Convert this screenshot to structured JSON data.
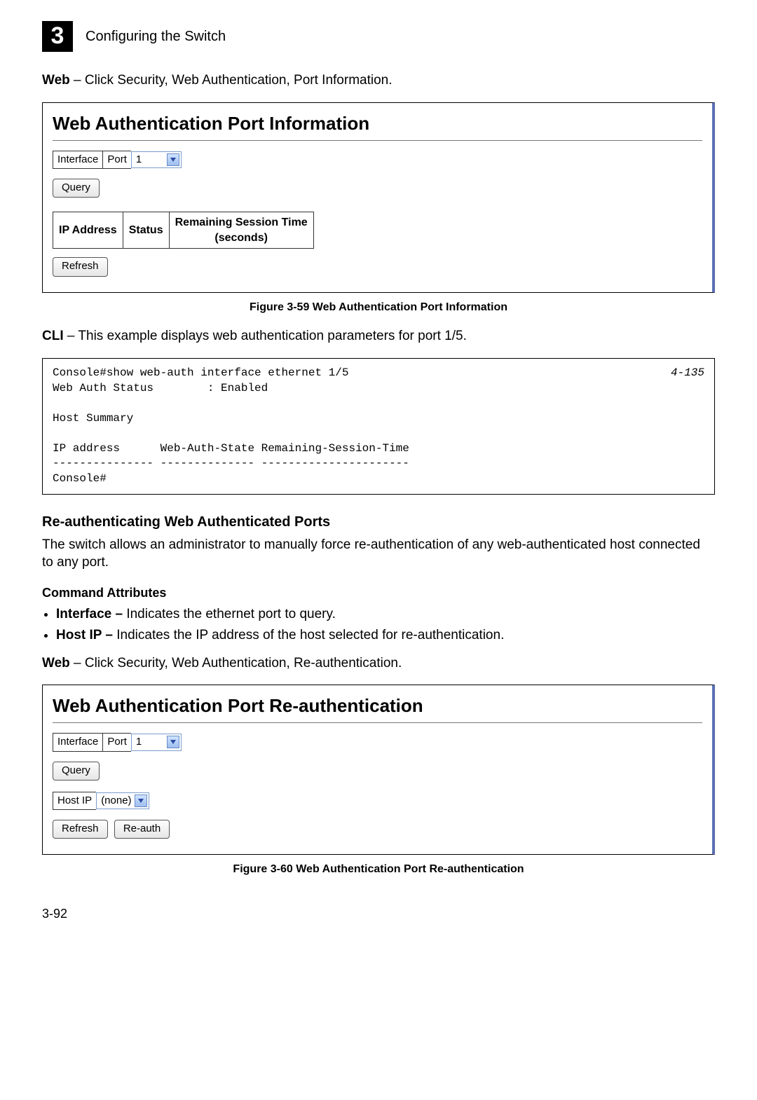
{
  "header": {
    "chapter_number": "3",
    "chapter_title": "Configuring the Switch"
  },
  "intro1": {
    "bold": "Web",
    "rest": " – Click Security, Web Authentication, Port Information."
  },
  "panel1": {
    "title": "Web Authentication Port Information",
    "interface_label": "Interface",
    "port_label": "Port",
    "port_value": "1",
    "query_btn": "Query",
    "refresh_btn": "Refresh",
    "th_ip": "IP Address",
    "th_status": "Status",
    "th_time_l1": "Remaining Session Time",
    "th_time_l2": "(seconds)"
  },
  "caption1": "Figure 3-59  Web Authentication Port Information",
  "cli_intro": {
    "bold": "CLI",
    "rest": " – This example displays web authentication parameters for port 1/5."
  },
  "code": {
    "ref": "4-135",
    "body": "Console#show web-auth interface ethernet 1/5\nWeb Auth Status        : Enabled\n\nHost Summary\n\nIP address      Web-Auth-State Remaining-Session-Time\n--------------- -------------- ----------------------\nConsole#"
  },
  "section2": {
    "title": "Re-authenticating Web Authenticated Ports",
    "para": "The switch allows an administrator to manually force re-authentication of any web-authenticated host connected to any port.",
    "attr_heading": "Command Attributes",
    "b1_bold": "Interface –",
    "b1_rest": " Indicates the ethernet port to query.",
    "b2_bold": "Host IP –",
    "b2_rest": " Indicates the IP address of the host selected for re-authentication."
  },
  "intro2": {
    "bold": "Web",
    "rest": " – Click Security, Web Authentication, Re-authentication."
  },
  "panel2": {
    "title": "Web Authentication Port Re-authentication",
    "interface_label": "Interface",
    "port_label": "Port",
    "port_value": "1",
    "query_btn": "Query",
    "hostip_label": "Host IP",
    "hostip_value": "(none)",
    "refresh_btn": "Refresh",
    "reauth_btn": "Re-auth"
  },
  "caption2": "Figure 3-60  Web Authentication Port Re-authentication",
  "page_number": "3-92"
}
